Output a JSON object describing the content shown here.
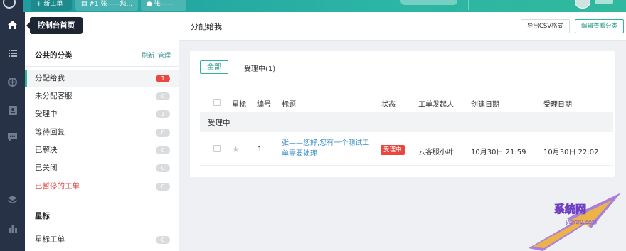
{
  "topbar": {
    "new_tab": "+ 新工单",
    "tab1": "#1 张——您...",
    "tab2": "张——"
  },
  "tooltip": {
    "text": "控制台首页"
  },
  "rail": {
    "icons": [
      "home-icon",
      "list-icon",
      "globe-icon",
      "contacts-icon",
      "chat-icon",
      "layers-icon",
      "stats-icon"
    ]
  },
  "categories": {
    "title": "公共的分类",
    "refresh": "刷新",
    "manage": "管理",
    "items": [
      {
        "label": "分配给我",
        "count": "1"
      },
      {
        "label": "未分配客服",
        "count": "0"
      },
      {
        "label": "受理中",
        "count": "1"
      },
      {
        "label": "等待回复",
        "count": "0"
      },
      {
        "label": "已解决",
        "count": "0"
      },
      {
        "label": "已关闭",
        "count": "0"
      },
      {
        "label": "已暂停的工单",
        "count": "0"
      }
    ],
    "star_title": "星标",
    "star_items": [
      {
        "label": "星标工单",
        "count": "0"
      }
    ]
  },
  "header": {
    "title": "分配给我",
    "export_label": "导出CSV格式",
    "edit_label": "编辑查看分类"
  },
  "filters": {
    "all": "全部",
    "processing": "受理中(1)"
  },
  "table": {
    "columns": [
      "星标",
      "编号",
      "标题",
      "状态",
      "工单发起人",
      "创建日期",
      "受理日期"
    ],
    "group": "受理中",
    "rows": [
      {
        "id": "1",
        "title": "张——您好,您有一个测试工单需要处理",
        "status": "受理中",
        "requester": "云客服小叶",
        "created": "10月30日 21:59",
        "accepted": "10月30日 22:02"
      }
    ]
  },
  "watermark": {
    "text": "系统网",
    "url": "yuxuu.com"
  },
  "colors": {
    "accent": "#2db59e",
    "danger": "#e9473f",
    "rail": "#283246",
    "link": "#3b8ec7"
  }
}
